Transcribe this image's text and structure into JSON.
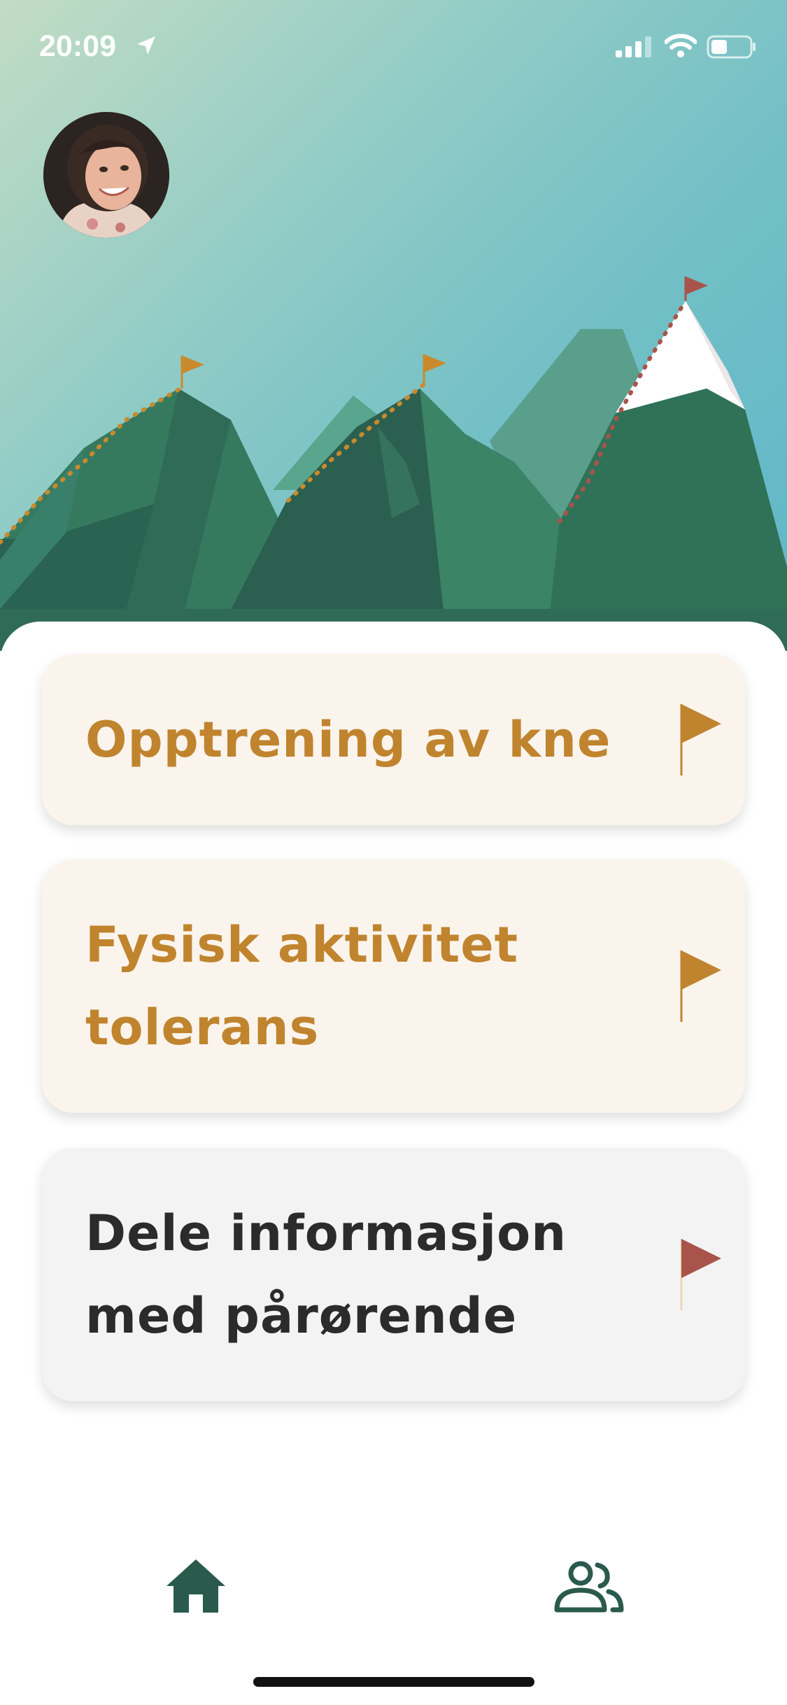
{
  "status_bar": {
    "time": "20:09",
    "icons": [
      "location-arrow-icon",
      "cellular-signal-icon",
      "wifi-icon",
      "battery-icon"
    ]
  },
  "profile": {
    "avatar_icon": "user-avatar"
  },
  "hero": {
    "illustration": "mountain-peaks-with-flags"
  },
  "cards": [
    {
      "label": "Opptrening av kne",
      "flag_color": "#c0842e",
      "style": "orange"
    },
    {
      "label": "Fysisk aktivitet tolerans",
      "flag_color": "#c0842e",
      "style": "orange"
    },
    {
      "label": "Dele informasjon med pårørende",
      "flag_color": "#a8544b",
      "style": "grey"
    }
  ],
  "tab_bar": {
    "items": [
      {
        "icon": "home-icon",
        "active": true
      },
      {
        "icon": "people-icon",
        "active": false
      }
    ]
  },
  "colors": {
    "accent_orange": "#c0842e",
    "accent_red": "#a8544b",
    "mountain_green": "#2f6f57"
  }
}
